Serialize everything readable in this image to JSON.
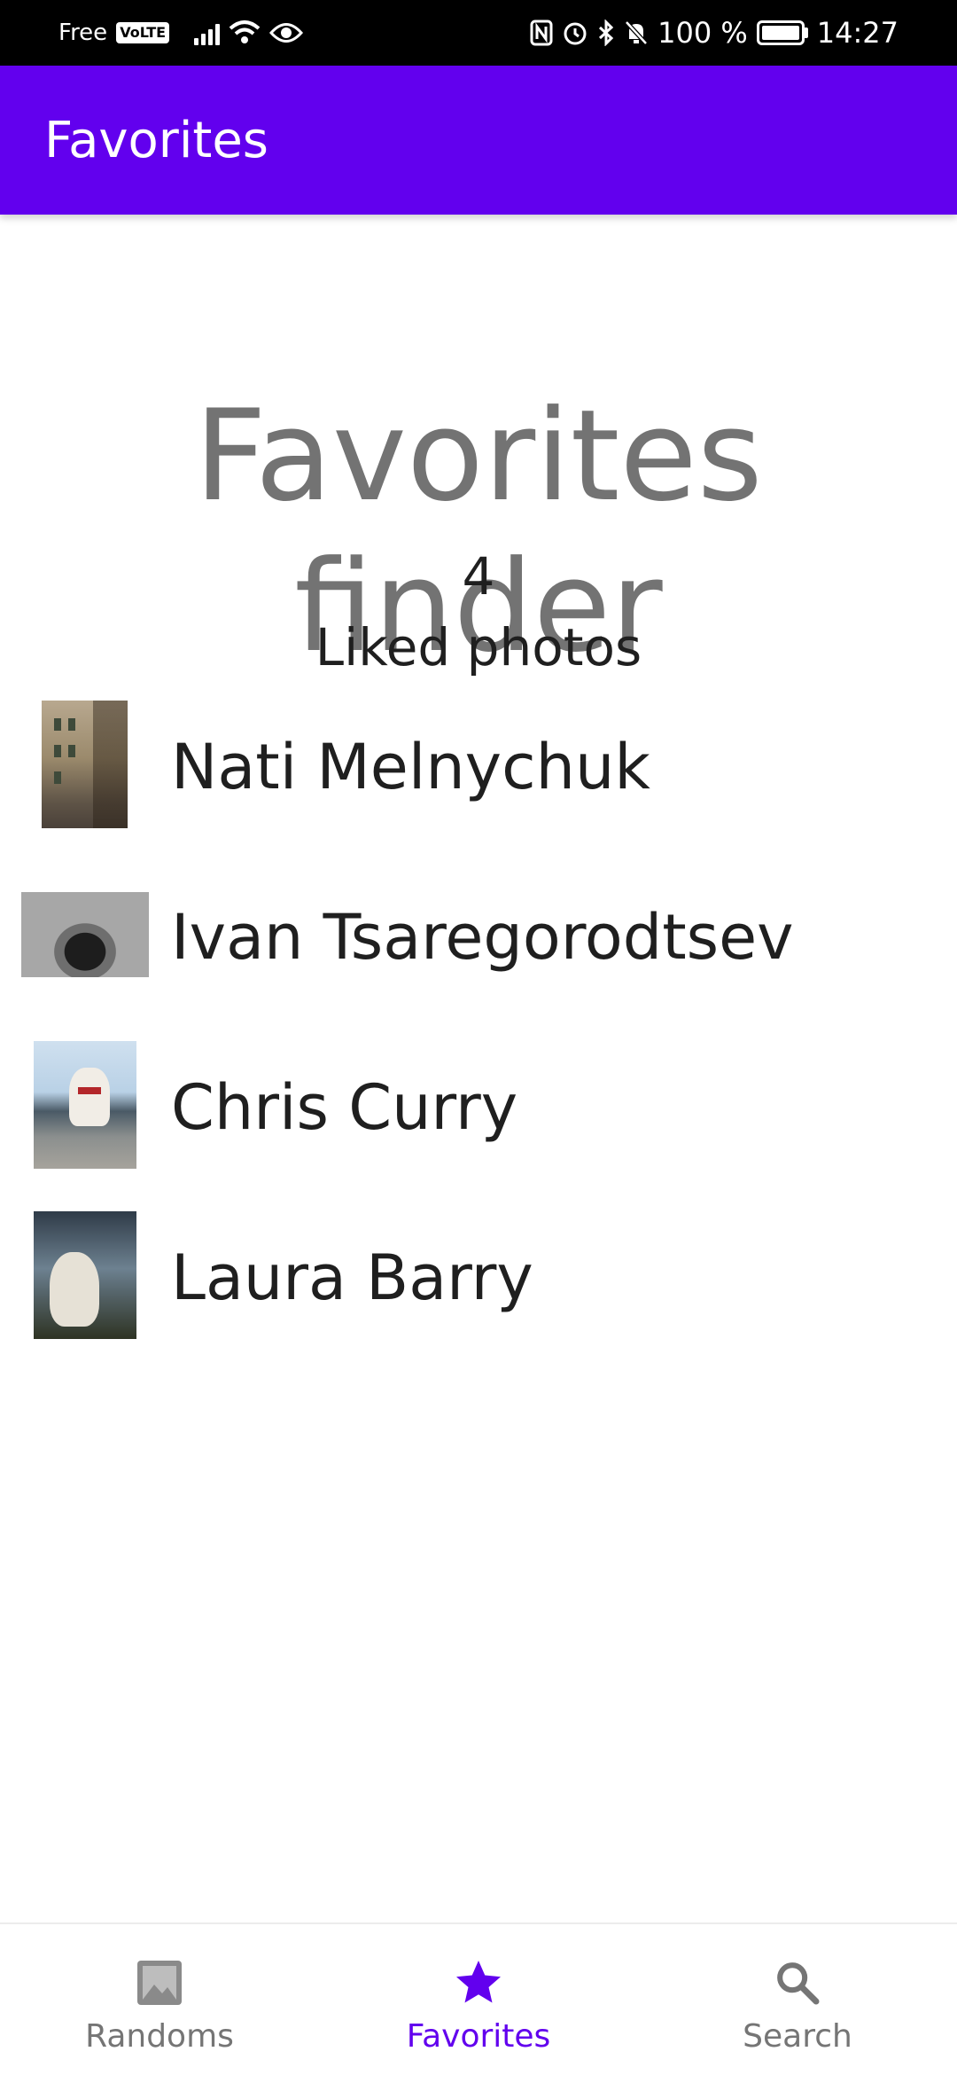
{
  "status_bar": {
    "carrier": "Free",
    "volte": "VoLTE",
    "battery": "100 %",
    "time": "14:27"
  },
  "app_bar": {
    "title": "Favorites"
  },
  "main": {
    "headline": "Favorites finder",
    "liked_count": "4",
    "liked_label": "Liked photos",
    "favorites": [
      {
        "name": "Nati Melnychuk",
        "thumb": "street-photo"
      },
      {
        "name": "Ivan Tsaregorodtsev",
        "thumb": "stone-arch-photo"
      },
      {
        "name": "Chris Curry",
        "thumb": "dog-on-pier-photo"
      },
      {
        "name": "Laura Barry",
        "thumb": "dog-by-lake-photo"
      }
    ]
  },
  "bottom_nav": {
    "items": [
      {
        "label": "Randoms",
        "icon": "image-icon",
        "active": false
      },
      {
        "label": "Favorites",
        "icon": "star-icon",
        "active": true
      },
      {
        "label": "Search",
        "icon": "search-icon",
        "active": false
      }
    ]
  },
  "colors": {
    "primary": "#6200ee",
    "headline": "#737373",
    "text": "#1f1f1f",
    "nav_inactive": "#757575"
  }
}
